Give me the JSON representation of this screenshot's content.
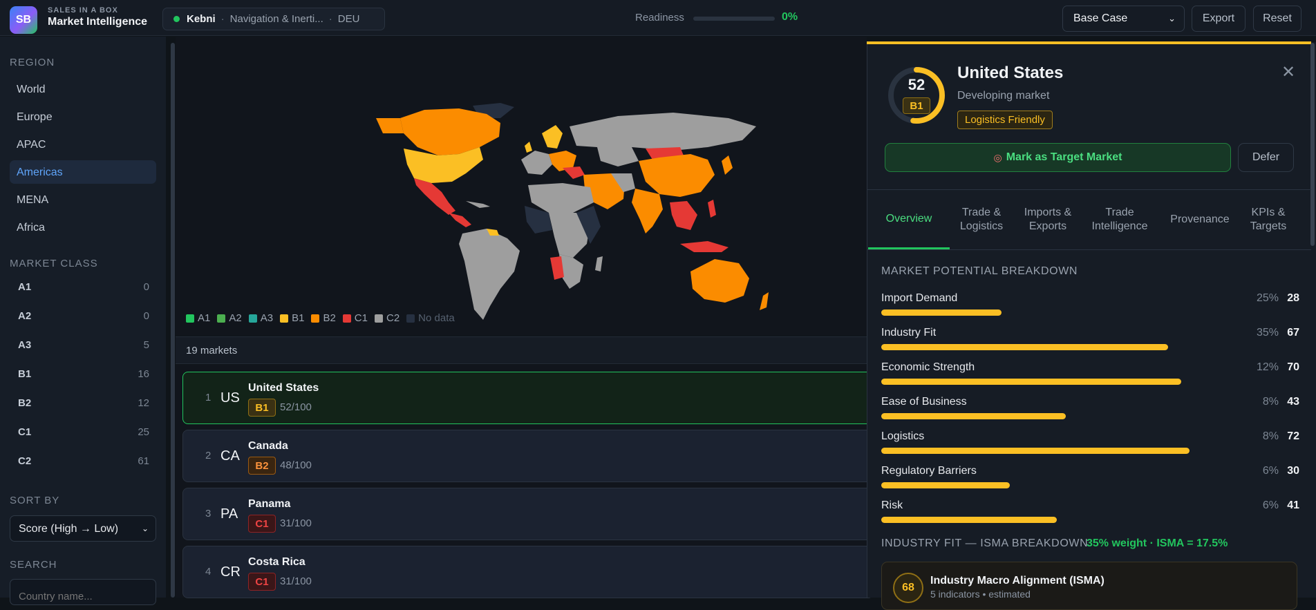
{
  "header": {
    "logo_text": "SB",
    "brand_small": "SALES IN A BOX",
    "brand_title": "Market Intelligence",
    "company": {
      "name": "Kebni",
      "sector": "Navigation & Inerti...",
      "country": "DEU"
    },
    "readiness_label": "Readiness",
    "readiness_value": "0%",
    "readiness_fraction": 0,
    "scenario": "Base Case",
    "export_label": "Export",
    "reset_label": "Reset"
  },
  "sidebar": {
    "region_label": "REGION",
    "regions": [
      "World",
      "Europe",
      "APAC",
      "Americas",
      "MENA",
      "Africa"
    ],
    "active_region": "Americas",
    "class_label": "MARKET CLASS",
    "classes": [
      {
        "k": "A1",
        "v": "0"
      },
      {
        "k": "A2",
        "v": "0"
      },
      {
        "k": "A3",
        "v": "5"
      },
      {
        "k": "B1",
        "v": "16"
      },
      {
        "k": "B2",
        "v": "12"
      },
      {
        "k": "C1",
        "v": "25"
      },
      {
        "k": "C2",
        "v": "61"
      }
    ],
    "sort_label": "SORT BY",
    "sort_value": "Score (High → Low)",
    "search_label": "SEARCH",
    "search_placeholder": "Country name..."
  },
  "map": {
    "legend": [
      {
        "label": "A1",
        "color": "#22c55e"
      },
      {
        "label": "A2",
        "color": "#4caf50"
      },
      {
        "label": "A3",
        "color": "#26a69a"
      },
      {
        "label": "B1",
        "color": "#fbbf24"
      },
      {
        "label": "B2",
        "color": "#fb8c00"
      },
      {
        "label": "C1",
        "color": "#e53935"
      },
      {
        "label": "C2",
        "color": "#9e9e9e"
      },
      {
        "label": "No data",
        "color": "#263041"
      }
    ]
  },
  "list": {
    "count": "19 markets",
    "rows": [
      {
        "rank": "1",
        "code": "US",
        "name": "United States",
        "cls": "B1",
        "score": "52/100"
      },
      {
        "rank": "2",
        "code": "CA",
        "name": "Canada",
        "cls": "B2",
        "score": "48/100"
      },
      {
        "rank": "3",
        "code": "PA",
        "name": "Panama",
        "cls": "C1",
        "score": "31/100"
      },
      {
        "rank": "4",
        "code": "CR",
        "name": "Costa Rica",
        "cls": "C1",
        "score": "31/100"
      }
    ]
  },
  "panel": {
    "score": "52",
    "score_fraction": 0.52,
    "cls": "B1",
    "title": "United States",
    "subtitle": "Developing market",
    "tag": "Logistics Friendly",
    "target_icon": "target-icon",
    "target_label": "Mark as Target Market",
    "defer_label": "Defer",
    "tabs": [
      "Overview",
      "Trade & Logistics",
      "Imports & Exports",
      "Trade Intelligence",
      "Provenance",
      "KPIs & Targets"
    ],
    "breakdown_title": "MARKET POTENTIAL BREAKDOWN",
    "metrics": [
      {
        "label": "Import Demand",
        "weight": "25%",
        "score": "28",
        "value": 28
      },
      {
        "label": "Industry Fit",
        "weight": "35%",
        "score": "67",
        "value": 67
      },
      {
        "label": "Economic Strength",
        "weight": "12%",
        "score": "70",
        "value": 70
      },
      {
        "label": "Ease of Business",
        "weight": "8%",
        "score": "43",
        "value": 43
      },
      {
        "label": "Logistics",
        "weight": "8%",
        "score": "72",
        "value": 72
      },
      {
        "label": "Regulatory Barriers",
        "weight": "6%",
        "score": "30",
        "value": 30
      },
      {
        "label": "Risk",
        "weight": "6%",
        "score": "41",
        "value": 41
      }
    ],
    "isma_title": "INDUSTRY FIT — ISMA BREAKDOWN",
    "isma_weight": "35% weight · ISMA = 17.5%",
    "isma_score": "68",
    "isma_name": "Industry Macro Alignment (ISMA)",
    "isma_sub": "5 indicators • estimated"
  }
}
